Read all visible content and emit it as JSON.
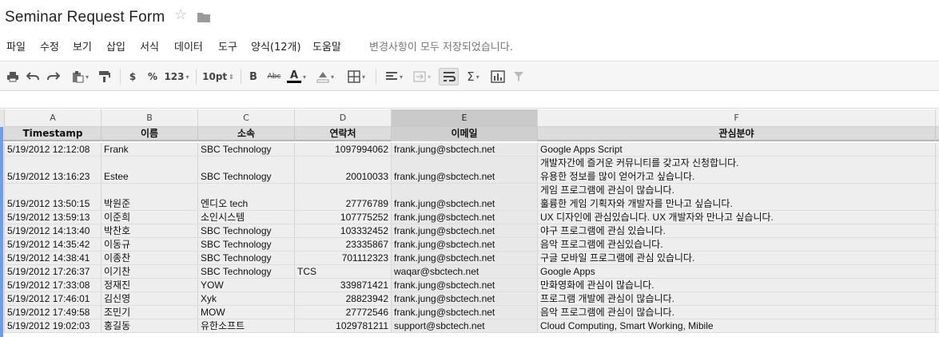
{
  "title": {
    "doc_name": "Seminar Request Form",
    "star": "☆"
  },
  "menu": {
    "items": [
      "파일",
      "수정",
      "보기",
      "삽입",
      "서식",
      "데이터",
      "도구",
      "양식(12개)",
      "도움말"
    ],
    "save_status": "변경사항이 모두 저장되었습니다."
  },
  "toolbar": {
    "currency": "$",
    "percent": "%",
    "number_format": "123",
    "font_size": "10pt",
    "bold": "B",
    "strikethrough": "Abc",
    "text_color": "A"
  },
  "columns": [
    "A",
    "B",
    "C",
    "D",
    "E",
    "F"
  ],
  "selected_column": "E",
  "headers": [
    "Timestamp",
    "이름",
    "소속",
    "연락처",
    "이메일",
    "관심분야"
  ],
  "rows": [
    {
      "timestamp": "5/19/2012 12:12:08",
      "name": "Frank",
      "org": "SBC Technology",
      "phone": "1097994062",
      "email": "frank.jung@sbctech.net",
      "interest": [
        "Google Apps Script"
      ]
    },
    {
      "timestamp": "5/19/2012 13:16:23",
      "name": "Estee",
      "org": "SBC Technology",
      "phone": "20010033",
      "email": "frank.jung@sbctech.net",
      "interest": [
        "개발자간에 즐거운 커뮤니티를 갖고자 신청합니다.",
        "유용한 정보를 많이 얻어가고 싶습니다."
      ]
    },
    {
      "timestamp": "5/19/2012 13:50:15",
      "name": "박원준",
      "org": "엔디오 tech",
      "phone": "27776789",
      "email": "frank.jung@sbctech.net",
      "interest": [
        "게임 프로그램에 관심이 많습니다.",
        "훌륭한 게임 기획자와 개발자를 만나고 싶습니다."
      ]
    },
    {
      "timestamp": "5/19/2012 13:59:13",
      "name": "이준희",
      "org": "소인시스템",
      "phone": "107775252",
      "email": "frank.jung@sbctech.net",
      "interest": [
        "UX 디자인에 관심있습니다. UX 개발자와 만나고 싶습니다."
      ]
    },
    {
      "timestamp": "5/19/2012 14:13:40",
      "name": "박찬호",
      "org": "SBC Technology",
      "phone": "103332452",
      "email": "frank.jung@sbctech.net",
      "interest": [
        "야구 프로그램에 관심 있습니다."
      ]
    },
    {
      "timestamp": "5/19/2012 14:35:42",
      "name": "이동규",
      "org": "SBC Technology",
      "phone": "23335867",
      "email": "frank.jung@sbctech.net",
      "interest": [
        "음악 프로그램에 관심있습니다."
      ]
    },
    {
      "timestamp": "5/19/2012 14:38:41",
      "name": "이종찬",
      "org": "SBC Technology",
      "phone": "701112323",
      "email": "frank.jung@sbctech.net",
      "interest": [
        "구글 모바일 프로그램에 관심 있습니다."
      ]
    },
    {
      "timestamp": "5/19/2012 17:26:37",
      "name": "이기찬",
      "org": "SBC Technology",
      "phone": "TCS",
      "email": "waqar@sbctech.net",
      "interest": [
        "Google Apps"
      ]
    },
    {
      "timestamp": "5/19/2012 17:33:08",
      "name": "정재진",
      "org": "YOW",
      "phone": "339871421",
      "email": "frank.jung@sbctech.net",
      "interest": [
        "만화영화에 관심이 많습니다."
      ]
    },
    {
      "timestamp": "5/19/2012 17:46:01",
      "name": "김신영",
      "org": "Xyk",
      "phone": "28823942",
      "email": "frank.jung@sbctech.net",
      "interest": [
        "프로그램 개발에 관심이 많습니다."
      ]
    },
    {
      "timestamp": "5/19/2012 17:49:58",
      "name": "조민기",
      "org": "MOW",
      "phone": "27772546",
      "email": "frank.jung@sbctech.net",
      "interest": [
        "음악 프로그램에 관심이 많습니다."
      ]
    },
    {
      "timestamp": "5/19/2012 19:02:03",
      "name": "홍길동",
      "org": "유한소프트",
      "phone": "1029781211",
      "email": "support@sbctech.net",
      "interest": [
        "Cloud Computing, Smart Working, Mibile"
      ]
    }
  ]
}
